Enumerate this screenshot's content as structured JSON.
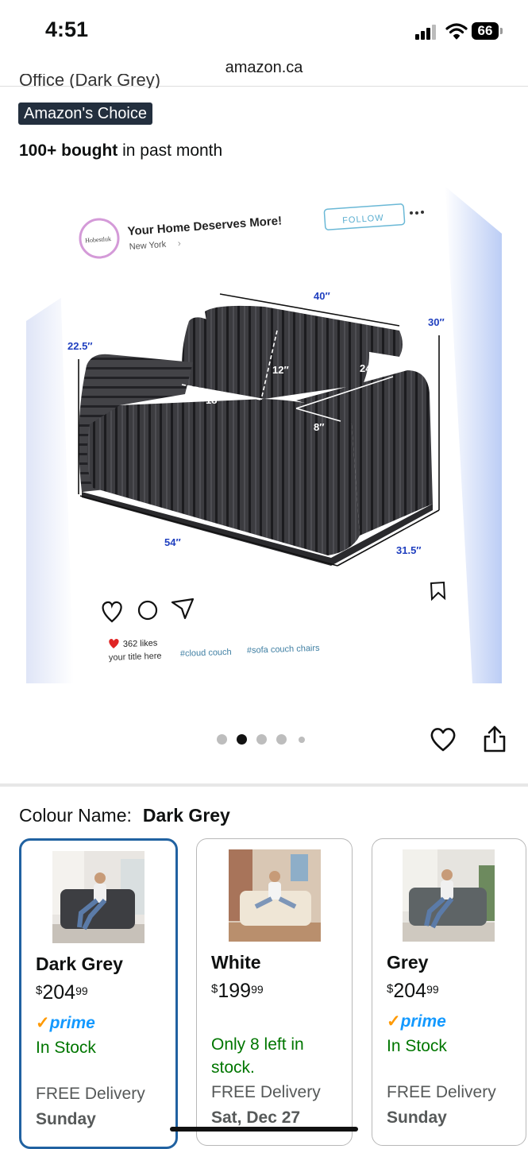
{
  "status": {
    "time": "4:51",
    "battery": "66"
  },
  "browser": {
    "url": "amazon.ca"
  },
  "product": {
    "title_partial": "Office (Dark Grey)",
    "badge": "Amazon's Choice",
    "bought_bold": "100+ bought",
    "bought_rest": " in past month"
  },
  "image": {
    "post_brand": "Hobestluk",
    "post_title": "Your Home Deserves More!",
    "post_location": "New York",
    "post_follow": "FOLLOW",
    "post_likes": "362 likes",
    "post_caption": "your title here",
    "post_tag1": "#cloud couch",
    "post_tag2": "#sofa couch chairs",
    "dims": [
      "40″",
      "30″",
      "22.5″",
      "12″",
      "24.5″",
      "18″",
      "8″",
      "54″",
      "31.5″"
    ],
    "carousel_total": 5,
    "carousel_active": 2
  },
  "colour": {
    "label": "Colour Name:",
    "selected": "Dark Grey",
    "options": [
      {
        "name": "Dark Grey",
        "currency": "$",
        "whole": "204",
        "cents": "99",
        "prime": "prime",
        "stock": "In Stock",
        "delivery": "FREE Delivery",
        "day": "Sunday",
        "sofa_color": "#3d3e42"
      },
      {
        "name": "White",
        "currency": "$",
        "whole": "199",
        "cents": "99",
        "prime": "",
        "stock": "Only 8 left in stock.",
        "delivery": "FREE Delivery",
        "day": "Sat, Dec 27",
        "sofa_color": "#efe6d6"
      },
      {
        "name": "Grey",
        "currency": "$",
        "whole": "204",
        "cents": "99",
        "prime": "prime",
        "stock": "In Stock",
        "delivery": "FREE Delivery",
        "day": "Sunday",
        "sofa_color": "#5e6466"
      }
    ]
  },
  "colors": {
    "badge_bg": "#232f3e",
    "selected_border": "#2162a1",
    "stock_green": "#007600",
    "prime_blue": "#1399ff",
    "prime_check": "#ff9900",
    "dim_blue": "#1f3fbf"
  },
  "icons": [
    "signal-icon",
    "wifi-icon",
    "battery-icon",
    "heart-icon",
    "share-icon",
    "comment-icon",
    "send-icon",
    "bookmark-icon",
    "more-icon"
  ]
}
